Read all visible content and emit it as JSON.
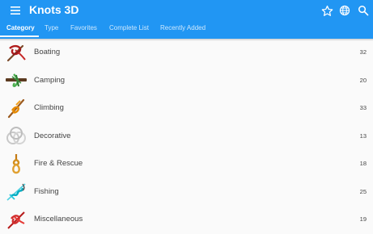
{
  "app": {
    "title": "Knots 3D",
    "menu_icon": "hamburger-menu-icon",
    "actions": [
      "star-icon",
      "globe-icon",
      "search-icon"
    ],
    "bar_color": "#2196f3"
  },
  "tabs": [
    {
      "label": "Category",
      "active": true
    },
    {
      "label": "Type",
      "active": false
    },
    {
      "label": "Favorites",
      "active": false
    },
    {
      "label": "Complete List",
      "active": false
    },
    {
      "label": "Recently Added",
      "active": false
    }
  ],
  "categories": [
    {
      "label": "Boating",
      "count": "32",
      "icon": "boating-knot-icon"
    },
    {
      "label": "Camping",
      "count": "20",
      "icon": "camping-knot-icon"
    },
    {
      "label": "Climbing",
      "count": "33",
      "icon": "climbing-knot-icon"
    },
    {
      "label": "Decorative",
      "count": "13",
      "icon": "decorative-knot-icon"
    },
    {
      "label": "Fire & Rescue",
      "count": "18",
      "icon": "fire-rescue-knot-icon"
    },
    {
      "label": "Fishing",
      "count": "25",
      "icon": "fishing-knot-icon"
    },
    {
      "label": "Miscellaneous",
      "count": "19",
      "icon": "miscellaneous-knot-icon"
    }
  ]
}
